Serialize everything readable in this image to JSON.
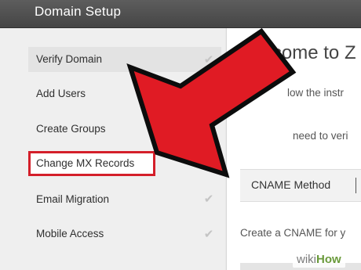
{
  "header": {
    "title": "Domain Setup"
  },
  "sidebar": {
    "items": [
      {
        "label": "Verify Domain",
        "checked": true
      },
      {
        "label": "Add Users",
        "checked": false
      },
      {
        "label": "Create Groups",
        "checked": false
      },
      {
        "label": "Change MX Records",
        "checked": true
      },
      {
        "label": "Email Migration",
        "checked": true
      },
      {
        "label": "Mobile Access",
        "checked": true
      }
    ]
  },
  "content": {
    "welcome": "Welcome to Z",
    "line1": "low the instr",
    "line2": "need to veri",
    "method_label": "CNAME Method",
    "line3": "Create a CNAME for y"
  },
  "watermark": {
    "wiki": "wiki",
    "how": "How"
  },
  "colors": {
    "highlight": "#d41f2a",
    "arrow": "#e01b24",
    "header": "#4f4f4f"
  },
  "icons": {
    "check": "check-icon",
    "arrow": "pointer-arrow"
  }
}
